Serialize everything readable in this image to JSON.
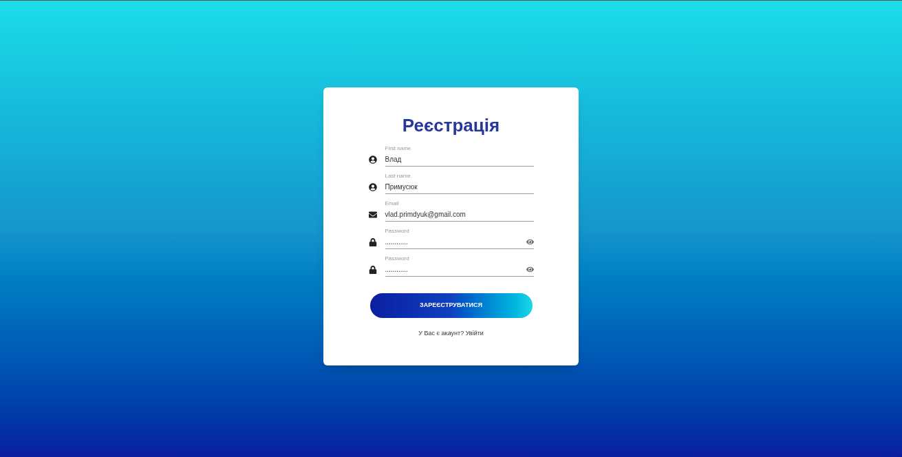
{
  "title": "Реєстрація",
  "fields": [
    {
      "kind": "person",
      "label": "First name",
      "value": "Влад",
      "masked": false
    },
    {
      "kind": "person",
      "label": "Last name",
      "value": "Примусюк",
      "masked": false
    },
    {
      "kind": "mail",
      "label": "Email",
      "value": "vlad.primdyuk@gmail.com",
      "masked": false
    },
    {
      "kind": "lock",
      "label": "Password",
      "value": "............",
      "masked": true
    },
    {
      "kind": "lock",
      "label": "Password",
      "value": "............",
      "masked": true
    }
  ],
  "submit": "ЗАРЕЄСТРУВАТИСЯ",
  "login_link": "У Вас є акаунт? Увійти"
}
